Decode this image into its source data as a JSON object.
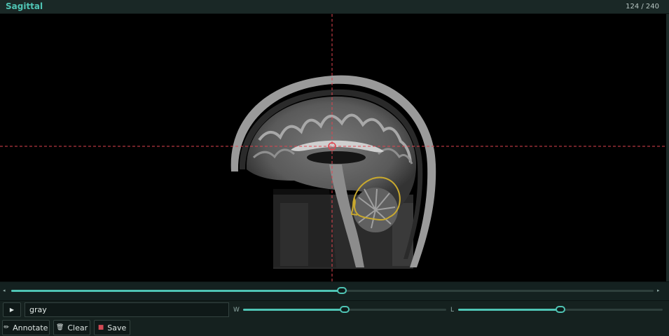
{
  "header": {
    "title": "Sagittal",
    "slice_counter": "124 / 240"
  },
  "slice": {
    "current": 124,
    "total": 240,
    "fraction": 0.51
  },
  "controls": {
    "colormap_value": "gray",
    "window_label": "W",
    "window_level_fraction": 0.5,
    "level_label": "L",
    "level_fraction": 0.5
  },
  "buttons": {
    "play_icon": "play-icon",
    "annotate_label": "Annotate",
    "clear_label": "Clear",
    "save_label": "Save"
  },
  "colors": {
    "accent": "#4fc4b4",
    "crosshair": "#e0444f",
    "annotation": "#c9a92e"
  }
}
